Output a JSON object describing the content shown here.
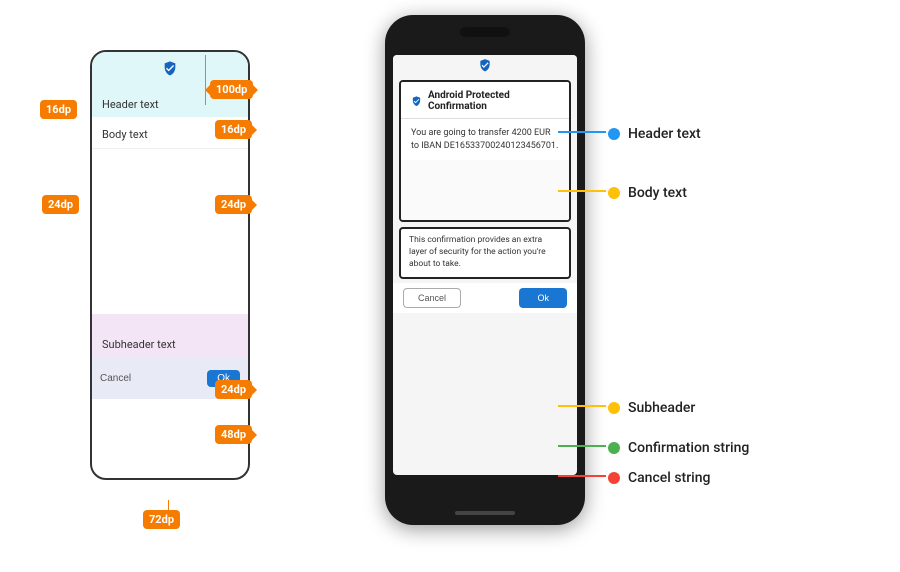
{
  "left_diagram": {
    "dimensions": {
      "top_space": "100dp",
      "left_margin": "16dp",
      "right_margin_header": "16dp",
      "body_bottom": "24dp",
      "right_margin_body": "24dp",
      "subheader_top": "24dp",
      "subheader_bottom": "48dp",
      "button_height": "72dp"
    },
    "labels": {
      "header_text": "Header text",
      "body_text": "Body text",
      "subheader_text": "Subheader text",
      "cancel_btn": "Cancel",
      "ok_btn": "Ok"
    }
  },
  "right_phone": {
    "dialog": {
      "title": "Android Protected Confirmation",
      "body": "You are going to transfer 4200 EUR to IBAN DE16533700240123456701.",
      "subheader": "This confirmation provides an extra layer of security for the action you're about to take.",
      "cancel_btn": "Cancel",
      "ok_btn": "Ok"
    }
  },
  "callouts": [
    {
      "label": "Header text",
      "color": "#2196f3"
    },
    {
      "label": "Body text",
      "color": "#ffc107"
    },
    {
      "label": "Subheader",
      "color": "#ffc107"
    },
    {
      "label": "Confirmation string",
      "color": "#4caf50"
    },
    {
      "label": "Cancel string",
      "color": "#f44336"
    }
  ]
}
